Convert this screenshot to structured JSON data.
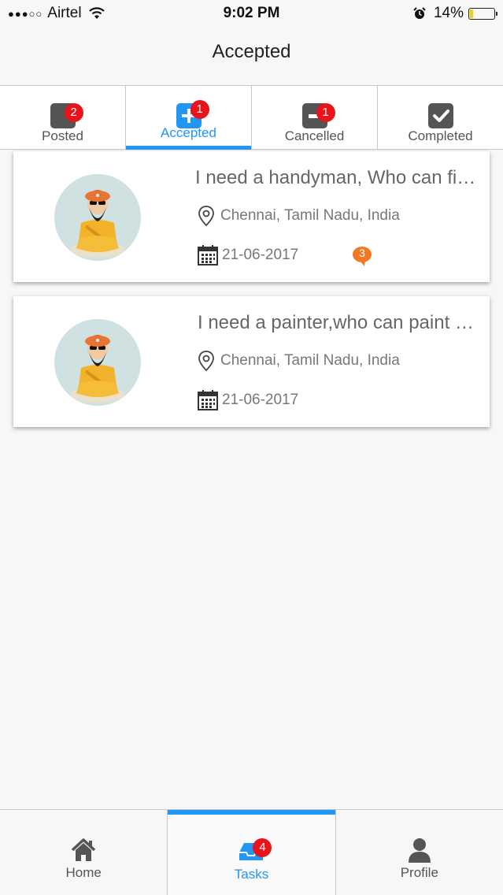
{
  "status_bar": {
    "carrier": "Airtel",
    "signal": "●●●○○",
    "time": "9:02 PM",
    "battery_percent_text": "14%",
    "battery_level": 0.14
  },
  "header": {
    "title": "Accepted"
  },
  "tabs": [
    {
      "label": "Posted",
      "badge": "2",
      "icon": "inbox-icon"
    },
    {
      "label": "Accepted",
      "badge": "1",
      "icon": "plus-icon"
    },
    {
      "label": "Cancelled",
      "badge": "1",
      "icon": "minus-icon"
    },
    {
      "label": "Completed",
      "badge": "",
      "icon": "check-icon"
    }
  ],
  "tasks": [
    {
      "title": "I need a handyman, Who can fix my doors",
      "location": "Chennai, Tamil Nadu, India",
      "date": "21-06-2017",
      "comments": "3"
    },
    {
      "title": "I need a painter,who can paint my house",
      "location": "Chennai, Tamil Nadu, India",
      "date": "21-06-2017",
      "comments": ""
    }
  ],
  "bottom_nav": [
    {
      "label": "Home",
      "badge": "",
      "icon": "home-icon"
    },
    {
      "label": "Tasks",
      "badge": "4",
      "icon": "tasks-icon"
    },
    {
      "label": "Profile",
      "badge": "",
      "icon": "profile-icon"
    }
  ],
  "colors": {
    "accent": "#2196f3",
    "badge": "#e8141c",
    "comment_badge": "#f07826"
  }
}
